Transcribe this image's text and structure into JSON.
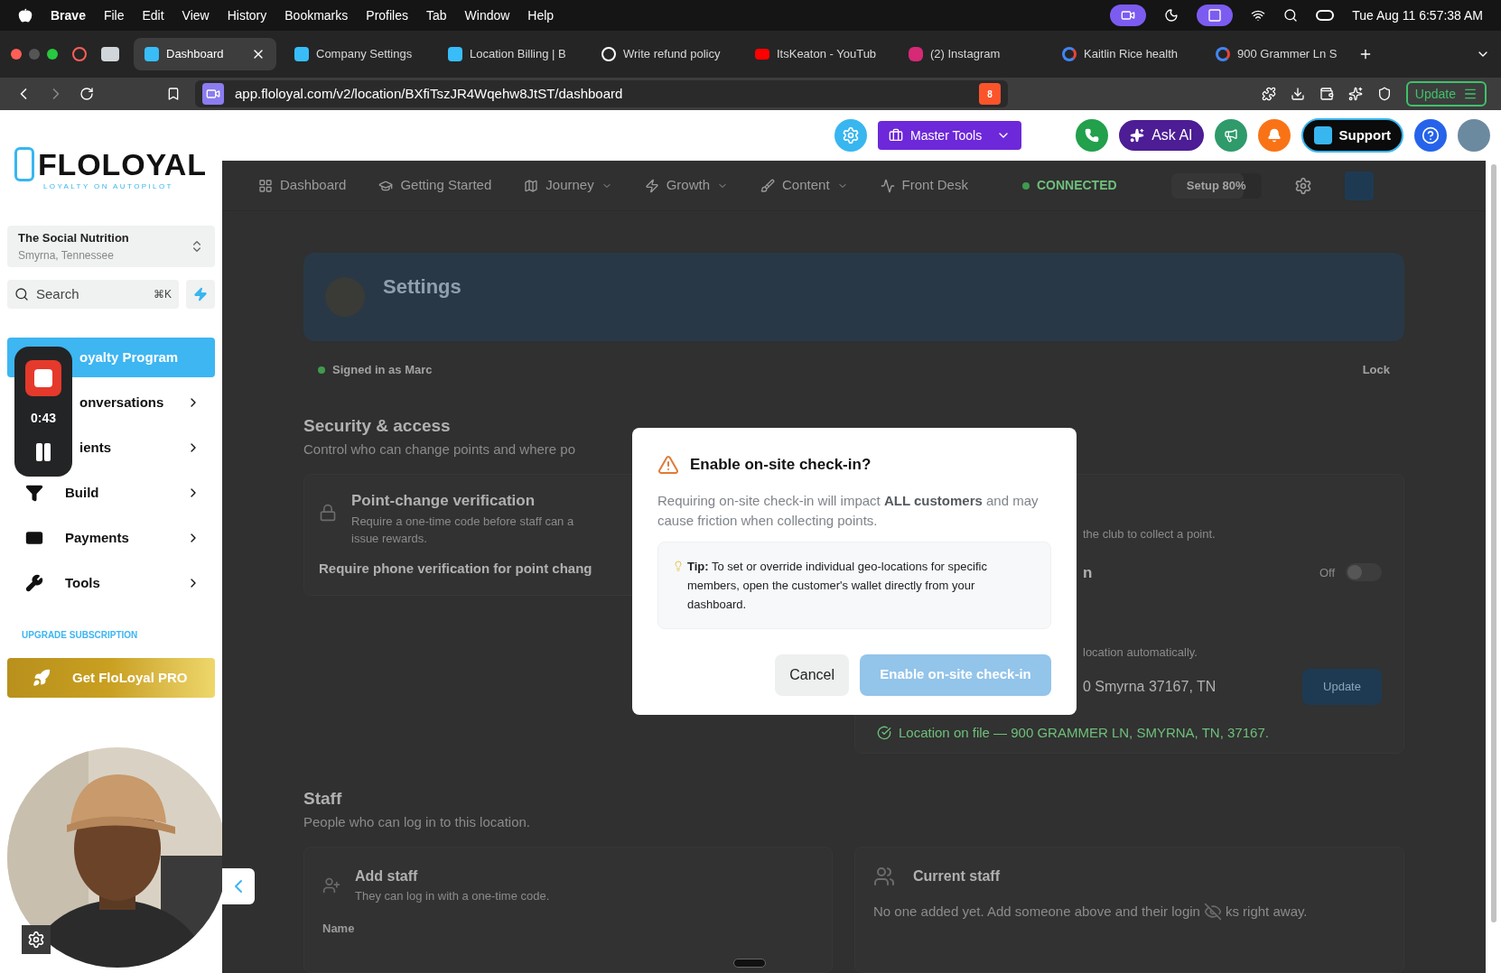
{
  "menubar": {
    "app": "Brave",
    "menus": [
      "File",
      "Edit",
      "View",
      "History",
      "Bookmarks",
      "Profiles",
      "Tab",
      "Window",
      "Help"
    ],
    "clock": "Tue Aug 11 6:57:38 AM"
  },
  "tabs": [
    {
      "title": "Dashboard",
      "selected": true,
      "kind": "app"
    },
    {
      "title": "Company Settings",
      "selected": false,
      "kind": "app"
    },
    {
      "title": "Location Billing | B",
      "selected": false,
      "kind": "app"
    },
    {
      "title": "Write refund policy",
      "selected": false,
      "kind": "chat"
    },
    {
      "title": "ItsKeaton - YouTub",
      "selected": false,
      "kind": "video"
    },
    {
      "title": "(2) Instagram",
      "selected": false,
      "kind": "insta"
    },
    {
      "title": "Kaitlin Rice health",
      "selected": false,
      "kind": "google"
    },
    {
      "title": "900 Grammer Ln S",
      "selected": false,
      "kind": "google"
    }
  ],
  "address": {
    "url": "app.floloyal.com/v2/location/BXfiTszJR4Wqehw8JtST/dashboard",
    "shield_count": "8",
    "update": "Update"
  },
  "header": {
    "master_tools": "Master Tools",
    "ask_ai": "Ask AI",
    "support": "Support"
  },
  "logo": {
    "name": "FLOLOYAL",
    "tagline": "LOYALTY ON AUTOPILOT"
  },
  "location": {
    "name": "The Social Nutrition",
    "city": "Smyrna, Tennessee"
  },
  "search": {
    "placeholder": "Search",
    "shortcut": "⌘K"
  },
  "nav": [
    {
      "label": "oyalty Program",
      "selected": true,
      "kind": "link"
    },
    {
      "label": "onversations",
      "selected": false,
      "kind": "group"
    },
    {
      "label": "ients",
      "selected": false,
      "kind": "group"
    },
    {
      "label": "Build",
      "selected": false,
      "kind": "group"
    },
    {
      "label": "Payments",
      "selected": false,
      "kind": "group"
    },
    {
      "label": "Tools",
      "selected": false,
      "kind": "group"
    }
  ],
  "recorder": {
    "time": "0:43"
  },
  "upgrade": {
    "label": "UPGRADE SUBSCRIPTION",
    "cta": "Get FloLoyal PRO"
  },
  "topnav": [
    {
      "label": "Dashboard",
      "dropdown": false
    },
    {
      "label": "Getting Started",
      "dropdown": false
    },
    {
      "label": "Journey",
      "dropdown": true
    },
    {
      "label": "Growth",
      "dropdown": true
    },
    {
      "label": "Content",
      "dropdown": true
    },
    {
      "label": "Front Desk",
      "dropdown": false
    }
  ],
  "status": "CONNECTED",
  "setup": {
    "label": "Setup 80%",
    "level": 0.8
  },
  "page": {
    "title": "Settings",
    "signed_in": "Signed in as Marc",
    "lock": "Lock",
    "security": {
      "title": "Security & access",
      "subtitle": "Control who can change points and where po",
      "card_title": "Point-change verification",
      "card_text": "Require a one-time code before staff can a",
      "card_text_2": "issue rewards.",
      "card_row": "Require phone verification for point chang",
      "right_text": "the club to collect a point.",
      "right_row": "n",
      "toggle_label": "Off",
      "toggle_on": false,
      "auto_text": "location automatically.",
      "address_value": "0 Smyrna 37167, TN",
      "update": "Update",
      "on_file": "Location on file — 900 GRAMMER LN, SMYRNA, TN, 37167."
    },
    "staff": {
      "title": "Staff",
      "subtitle": "People who can log in to this location.",
      "add_title": "Add staff",
      "add_text": "They can log in with a one-time code.",
      "name_label": "Name",
      "current_title": "Current staff",
      "current_text": "No one added yet. Add someone above and their login",
      "current_text_2": "ks right away."
    }
  },
  "modal": {
    "title": "Enable on-site check-in?",
    "body": "Requiring on-site check-in will impact **ALL customers** and may cause friction when collecting points.",
    "tip": "**Tip:** To set or override individual geo-locations for specific members, open the customer's wallet directly from your dashboard.",
    "cancel": "Cancel",
    "confirm": "Enable on-site check-in"
  }
}
